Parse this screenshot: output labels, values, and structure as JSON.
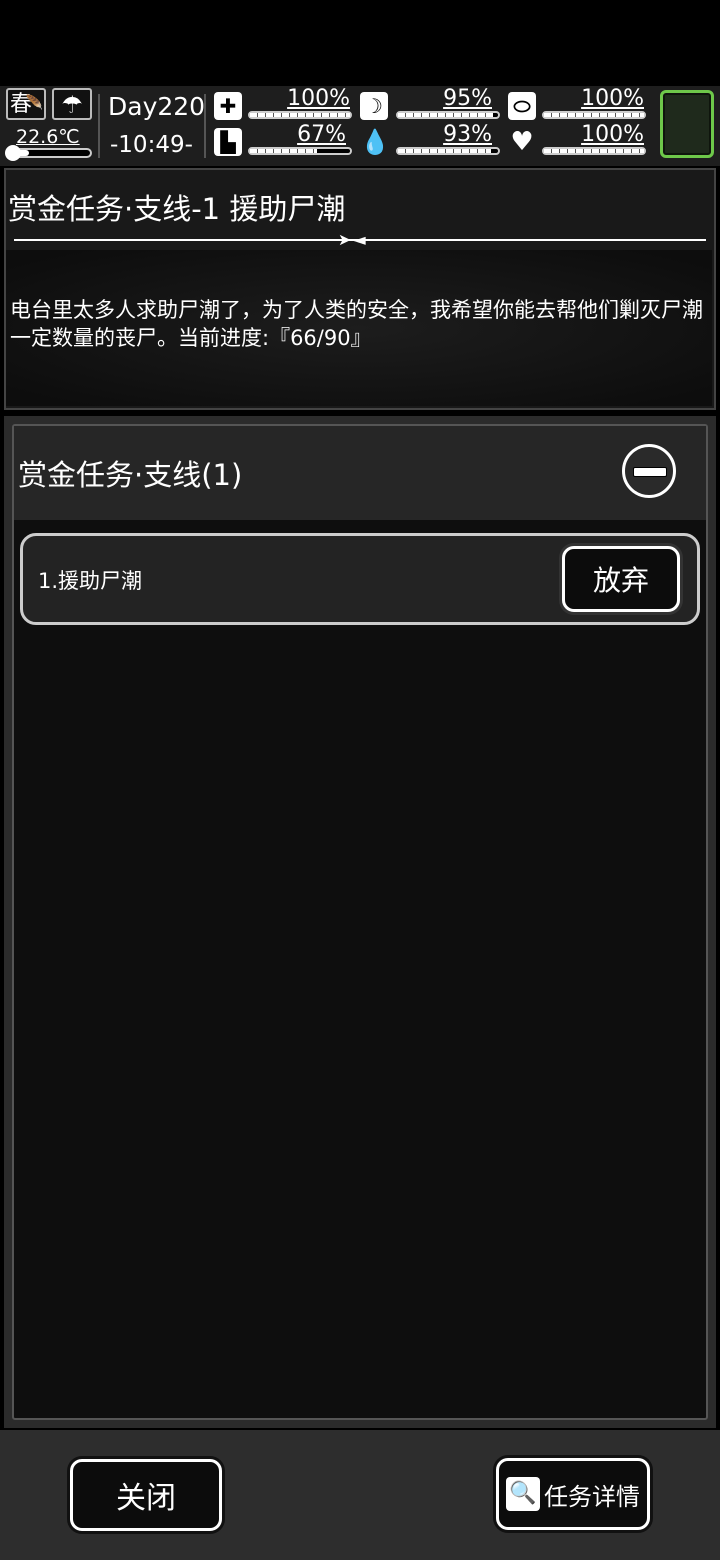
{
  "status": {
    "season": "春",
    "season_icon": "leaf-icon",
    "weather_icon": "rain-cloud-icon",
    "temperature": "22.6℃",
    "temperature_level": 0.25,
    "day": "Day220",
    "time": "-10:49-",
    "stats": [
      {
        "name": "health",
        "icon": "first-aid-kit-icon",
        "glyph": "✚",
        "value": "100%",
        "level": 1.0
      },
      {
        "name": "hunger",
        "icon": "stomach-icon",
        "glyph": "☽",
        "value": "95%",
        "level": 0.95
      },
      {
        "name": "medicine",
        "icon": "pill-icon",
        "glyph": "⬭",
        "value": "100%",
        "level": 1.0
      },
      {
        "name": "stamina",
        "icon": "foot-icon",
        "glyph": "▙",
        "value": "67%",
        "level": 0.67
      },
      {
        "name": "thirst",
        "icon": "water-drop-icon",
        "glyph": "💧",
        "value": "93%",
        "level": 0.93
      },
      {
        "name": "mood",
        "icon": "heart-icon",
        "glyph": "♥",
        "value": "100%",
        "level": 1.0
      }
    ]
  },
  "description": {
    "title": "赏金任务·支线-1 援助尸潮",
    "body": "电台里太多人求助尸潮了，为了人类的安全，我希望你能去帮他们剿灭尸潮一定数量的丧尸。当前进度:『66/90』"
  },
  "task_group": {
    "title": "赏金任务·支线(1)",
    "collapse_icon": "collapse-minus-icon",
    "tasks": [
      {
        "label": "1.援助尸潮",
        "action": "放弃"
      }
    ]
  },
  "footer": {
    "close_label": "关闭",
    "detail_label": "任务详情",
    "detail_icon": "task-detail-search-icon"
  },
  "colors": {
    "minimap_border": "#6ec84a",
    "panel_bg": "#2b2b2b",
    "list_bg": "#0e0e0e"
  }
}
